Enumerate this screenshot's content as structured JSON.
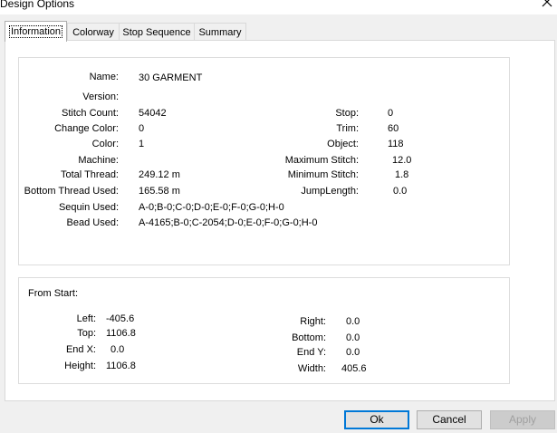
{
  "window": {
    "title": "Design Options",
    "close_glyph": "✕"
  },
  "tabs": [
    {
      "label": "Information",
      "active": true
    },
    {
      "label": "Colorway",
      "active": false
    },
    {
      "label": "Stop Sequence",
      "active": false
    },
    {
      "label": "Summary",
      "active": false
    }
  ],
  "info": {
    "name": {
      "label": "Name:",
      "value": "30 GARMENT"
    },
    "version": {
      "label": "Version:",
      "value": ""
    },
    "stitch_count": {
      "label": "Stitch Count:",
      "value": "54042"
    },
    "change_color": {
      "label": "Change Color:",
      "value": "0"
    },
    "color": {
      "label": "Color:",
      "value": "1"
    },
    "machine": {
      "label": "Machine:",
      "value": ""
    },
    "total_thread": {
      "label": "Total Thread:",
      "value": "249.12 m"
    },
    "bottom_thread": {
      "label": "Bottom Thread Used:",
      "value": "165.58 m"
    },
    "sequin_used": {
      "label": "Sequin Used:",
      "value": "A-0;B-0;C-0;D-0;E-0;F-0;G-0;H-0"
    },
    "bead_used": {
      "label": "Bead Used:",
      "value": "A-4165;B-0;C-2054;D-0;E-0;F-0;G-0;H-0"
    },
    "stop": {
      "label": "Stop:",
      "value": "0"
    },
    "trim": {
      "label": "Trim:",
      "value": "60"
    },
    "object": {
      "label": "Object:",
      "value": "118"
    },
    "max_stitch": {
      "label": "Maximum Stitch:",
      "value": "12.0"
    },
    "min_stitch": {
      "label": "Minimum Stitch:",
      "value": "1.8"
    },
    "jump_length": {
      "label": "JumpLength:",
      "value": "0.0"
    }
  },
  "from_start": {
    "heading": "From Start:",
    "left": {
      "label": "Left:",
      "value": "-405.6"
    },
    "top": {
      "label": "Top:",
      "value": "1106.8"
    },
    "end_x": {
      "label": "End X:",
      "value": "0.0"
    },
    "height": {
      "label": "Height:",
      "value": "1106.8"
    },
    "right": {
      "label": "Right:",
      "value": "0.0"
    },
    "bottom": {
      "label": "Bottom:",
      "value": "0.0"
    },
    "end_y": {
      "label": "End Y:",
      "value": "0.0"
    },
    "width": {
      "label": "Width:",
      "value": "405.6"
    }
  },
  "buttons": {
    "ok": "Ok",
    "cancel": "Cancel",
    "apply": "Apply"
  }
}
